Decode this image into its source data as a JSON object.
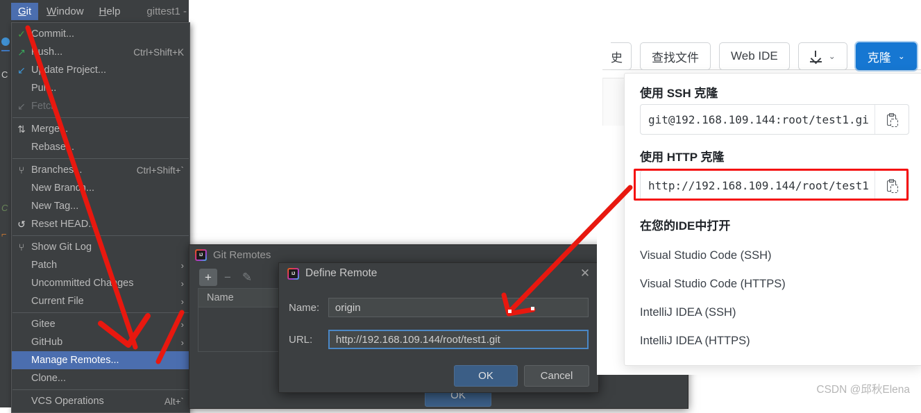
{
  "ide": {
    "menubar": [
      {
        "label": "Git",
        "mnemonic": "G",
        "active": true
      },
      {
        "label": "Window",
        "mnemonic": "W",
        "active": false
      },
      {
        "label": "Help",
        "mnemonic": "H",
        "active": false
      }
    ],
    "project_title": "gittest1 -",
    "git_menu": {
      "items": [
        {
          "icon": "check-icon",
          "label": "Commit...",
          "accel": "",
          "sub": false,
          "disabled": false,
          "selected": false
        },
        {
          "icon": "arrow-up-right-icon",
          "label": "Push...",
          "accel": "Ctrl+Shift+K",
          "sub": false,
          "disabled": false,
          "selected": false
        },
        {
          "icon": "arrow-down-left-icon",
          "label": "Update Project...",
          "accel": "",
          "sub": false,
          "disabled": false,
          "selected": false
        },
        {
          "icon": "",
          "label": "Pull...",
          "accel": "",
          "sub": false,
          "disabled": false,
          "selected": false
        },
        {
          "icon": "fetch-icon",
          "label": "Fetch",
          "accel": "",
          "sub": false,
          "disabled": true,
          "selected": false
        },
        {
          "sep": true
        },
        {
          "icon": "merge-icon",
          "label": "Merge...",
          "accel": "",
          "sub": false,
          "disabled": false,
          "selected": false
        },
        {
          "icon": "",
          "label": "Rebase...",
          "accel": "",
          "sub": false,
          "disabled": false,
          "selected": false
        },
        {
          "sep": true
        },
        {
          "icon": "branch-icon",
          "label": "Branches...",
          "accel": "Ctrl+Shift+`",
          "sub": false,
          "disabled": false,
          "selected": false
        },
        {
          "icon": "",
          "label": "New Branch...",
          "accel": "",
          "sub": false,
          "disabled": false,
          "selected": false
        },
        {
          "icon": "",
          "label": "New Tag...",
          "accel": "",
          "sub": false,
          "disabled": false,
          "selected": false
        },
        {
          "icon": "reset-icon",
          "label": "Reset HEAD...",
          "accel": "",
          "sub": false,
          "disabled": false,
          "selected": false
        },
        {
          "sep": true
        },
        {
          "icon": "branch-icon",
          "label": "Show Git Log",
          "accel": "",
          "sub": false,
          "disabled": false,
          "selected": false
        },
        {
          "icon": "",
          "label": "Patch",
          "accel": "",
          "sub": true,
          "disabled": false,
          "selected": false
        },
        {
          "icon": "",
          "label": "Uncommitted Changes",
          "accel": "",
          "sub": true,
          "disabled": false,
          "selected": false
        },
        {
          "icon": "",
          "label": "Current File",
          "accel": "",
          "sub": true,
          "disabled": false,
          "selected": false
        },
        {
          "sep": true
        },
        {
          "icon": "",
          "label": "Gitee",
          "accel": "",
          "sub": true,
          "disabled": false,
          "selected": false
        },
        {
          "icon": "",
          "label": "GitHub",
          "accel": "",
          "sub": true,
          "disabled": false,
          "selected": false
        },
        {
          "icon": "",
          "label": "Manage Remotes...",
          "accel": "",
          "sub": false,
          "disabled": false,
          "selected": true
        },
        {
          "icon": "",
          "label": "Clone...",
          "accel": "",
          "sub": false,
          "disabled": false,
          "selected": false
        },
        {
          "sep": true
        },
        {
          "icon": "",
          "label": "VCS Operations",
          "accel": "Alt+`",
          "sub": false,
          "disabled": false,
          "selected": false
        }
      ]
    }
  },
  "git_remotes_dialog": {
    "title": "Git Remotes",
    "toolbar": [
      {
        "name": "add-remote-button",
        "glyph": "+",
        "state": "on"
      },
      {
        "name": "remove-remote-button",
        "glyph": "−",
        "state": "dim"
      },
      {
        "name": "edit-remote-button",
        "glyph": "✎",
        "state": "dim"
      }
    ],
    "column_header": "Name",
    "ok_label": "OK"
  },
  "define_remote_dialog": {
    "title": "Define Remote",
    "close_label": "✕",
    "name_label": "Name:",
    "name_value": "origin",
    "url_label": "URL:",
    "url_value": "http://192.168.109.144/root/test1.git",
    "ok_label": "OK",
    "cancel_label": "Cancel"
  },
  "web_panel": {
    "toolbar": [
      {
        "name": "history-button",
        "label": "史",
        "clipped": true,
        "caret": false,
        "primary": false
      },
      {
        "name": "find-file-button",
        "label": "查找文件",
        "clipped": false,
        "caret": false,
        "primary": false
      },
      {
        "name": "web-ide-button",
        "label": "Web IDE",
        "clipped": false,
        "caret": false,
        "primary": false
      },
      {
        "name": "download-button",
        "label": "",
        "icon": "download-icon",
        "clipped": false,
        "caret": true,
        "primary": false
      },
      {
        "name": "clone-button",
        "label": "克隆",
        "clipped": false,
        "caret": true,
        "primary": true
      }
    ],
    "clone_dropdown": {
      "ssh_heading": "使用 SSH 克隆",
      "ssh_url": "git@192.168.109.144:root/test1.gi",
      "http_heading": "使用 HTTP 克隆",
      "http_url": "http://192.168.109.144/root/test1",
      "ide_heading": "在您的IDE中打开",
      "ide_links": [
        "Visual Studio Code (SSH)",
        "Visual Studio Code (HTTPS)",
        "IntelliJ IDEA (SSH)",
        "IntelliJ IDEA (HTTPS)"
      ],
      "copy_icon": "clipboard-icon"
    }
  },
  "annotations": {
    "highlight_color": "#f51010",
    "arrow_color": "#e8180f"
  },
  "watermark": "CSDN @邱秋Elena"
}
